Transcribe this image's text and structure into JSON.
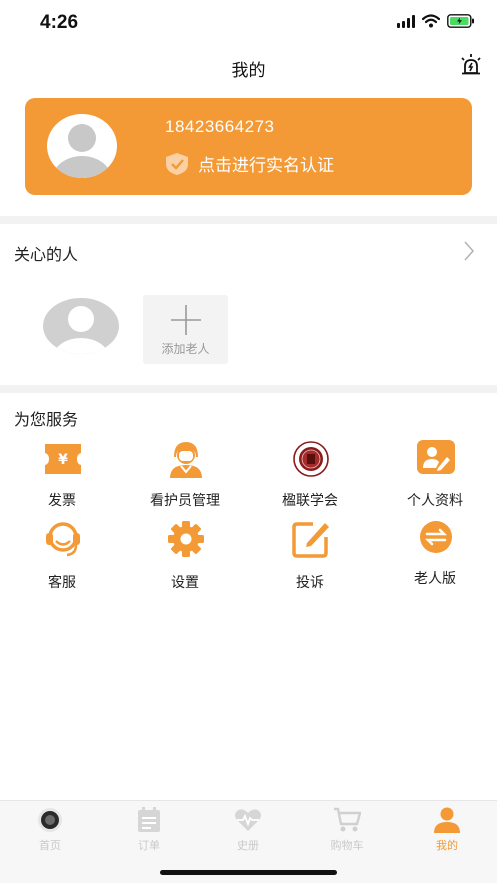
{
  "status_bar": {
    "time": "4:26"
  },
  "nav": {
    "title": "我的"
  },
  "profile": {
    "phone": "18423664273",
    "verify_text": "点击进行实名认证"
  },
  "care": {
    "title": "关心的人",
    "add_label": "添加老人"
  },
  "services": {
    "title": "为您服务",
    "items": [
      {
        "label": "发票",
        "icon": "invoice-icon"
      },
      {
        "label": "看护员管理",
        "icon": "caregiver-icon"
      },
      {
        "label": "楹联学会",
        "icon": "couplet-society-logo"
      },
      {
        "label": "个人资料",
        "icon": "profile-edit-icon"
      },
      {
        "label": "客服",
        "icon": "customer-service-icon"
      },
      {
        "label": "设置",
        "icon": "gear-icon"
      },
      {
        "label": "投诉",
        "icon": "complaint-icon"
      },
      {
        "label": "老人版",
        "icon": "switch-icon"
      }
    ]
  },
  "tabs": [
    {
      "label": "首页",
      "icon": "home-logo-icon",
      "active": false
    },
    {
      "label": "订单",
      "icon": "order-icon",
      "active": false
    },
    {
      "label": "史册",
      "icon": "heart-pulse-icon",
      "active": false
    },
    {
      "label": "购物车",
      "icon": "cart-icon",
      "active": false
    },
    {
      "label": "我的",
      "icon": "user-icon",
      "active": true
    }
  ],
  "colors": {
    "accent": "#f39a36",
    "tab_inactive": "#c9c9c9",
    "divider": "#f2f2f2"
  }
}
